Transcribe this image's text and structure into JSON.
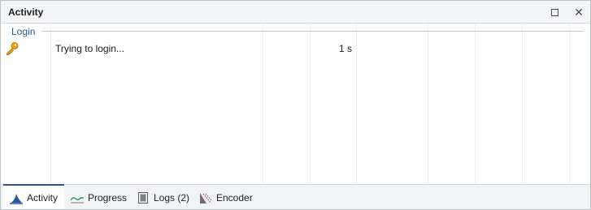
{
  "window": {
    "title": "Activity",
    "maximize_icon": "maximize-icon",
    "close_glyph": "✕"
  },
  "group": {
    "label": "Login"
  },
  "rows": [
    {
      "icon": "key-icon",
      "text": "Trying to login...",
      "time": "1 s"
    }
  ],
  "tabs": [
    {
      "label": "Activity",
      "icon": "activity-shark-icon",
      "active": true
    },
    {
      "label": "Progress",
      "icon": "progress-line-icon",
      "active": false
    },
    {
      "label": "Logs (2)",
      "icon": "logs-document-icon",
      "active": false
    },
    {
      "label": "Encoder",
      "icon": "encoder-icon",
      "active": false
    }
  ],
  "colors": {
    "accent": "#2b579a",
    "key": "#e8a317",
    "progress_line": "#2e9e57"
  }
}
